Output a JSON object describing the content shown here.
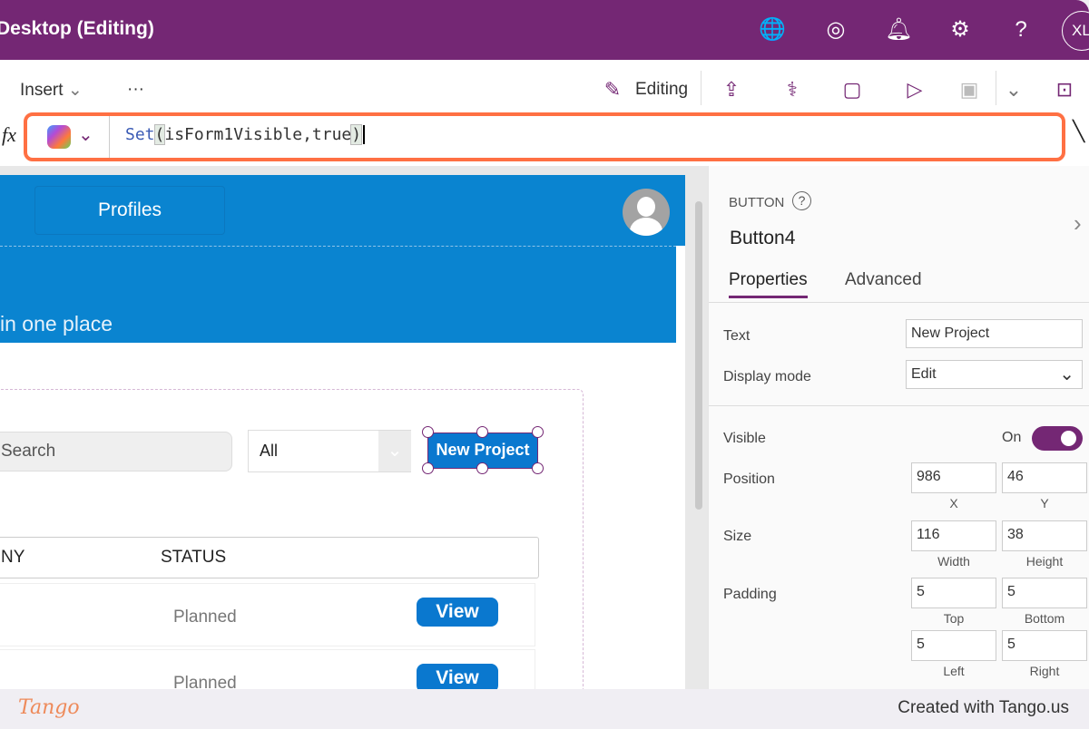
{
  "titlebar": {
    "title": "Desktop (Editing)",
    "avatar": "XL",
    "icons": [
      "environment-icon",
      "copilot-icon",
      "bell-icon",
      "gear-icon",
      "help-icon"
    ]
  },
  "toolbar": {
    "insert": "Insert",
    "more": "···",
    "editing": "Editing"
  },
  "formula": {
    "fx": "fx",
    "fn": "Set",
    "open": "(",
    "args": "isForm1Visible,true",
    "close": ")"
  },
  "canvas": {
    "profiles": "Profiles",
    "tagline": "in one place",
    "search_placeholder": "Search",
    "dropdown_value": "All",
    "new_project": "New Project",
    "columns": [
      "NY",
      "STATUS"
    ],
    "rows": [
      {
        "status": "Planned",
        "action": "View"
      },
      {
        "status": "Planned",
        "action": "View"
      }
    ]
  },
  "panel": {
    "type": "BUTTON",
    "name": "Button4",
    "tabs": [
      "Properties",
      "Advanced"
    ],
    "text_label": "Text",
    "text_value": "New Project",
    "display_label": "Display mode",
    "display_value": "Edit",
    "visible_label": "Visible",
    "visible_value": "On",
    "visible_on": true,
    "position_label": "Position",
    "x": "986",
    "y": "46",
    "x_label": "X",
    "y_label": "Y",
    "size_label": "Size",
    "width": "116",
    "height": "38",
    "width_label": "Width",
    "height_label": "Height",
    "padding_label": "Padding",
    "top": "5",
    "bottom": "5",
    "left": "5",
    "right": "5",
    "top_label": "Top",
    "bottom_label": "Bottom",
    "left_label": "Left",
    "right_label": "Right"
  },
  "footer": {
    "logo": "Tango",
    "credit": "Created with Tango.us"
  },
  "colors": {
    "brand": "#742774",
    "canvas_blue": "#0a84d0",
    "highlight": "#ff7043"
  }
}
